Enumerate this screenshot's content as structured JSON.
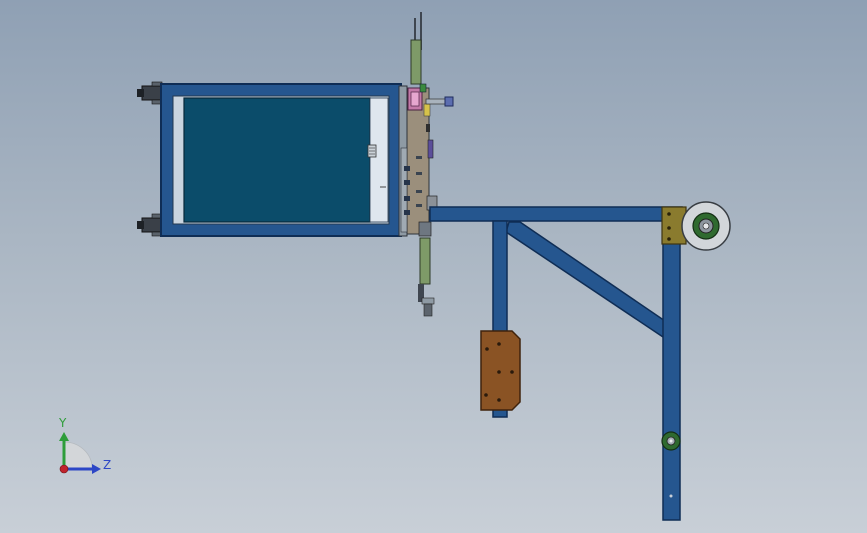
{
  "triad": {
    "y_label": "Y",
    "z_label": "Z"
  },
  "colors": {
    "frame_blue": "#25568f",
    "frame_stroke": "#0f2d55",
    "panel_teal": "#0b4c6a",
    "wood_plate": "#8a5324",
    "wheel_green": "#2f6a2f",
    "rail_green": "#7e9a68",
    "axis_y": "#2e9d3a",
    "axis_z": "#2d47c6",
    "axis_x": "#c0232d"
  }
}
